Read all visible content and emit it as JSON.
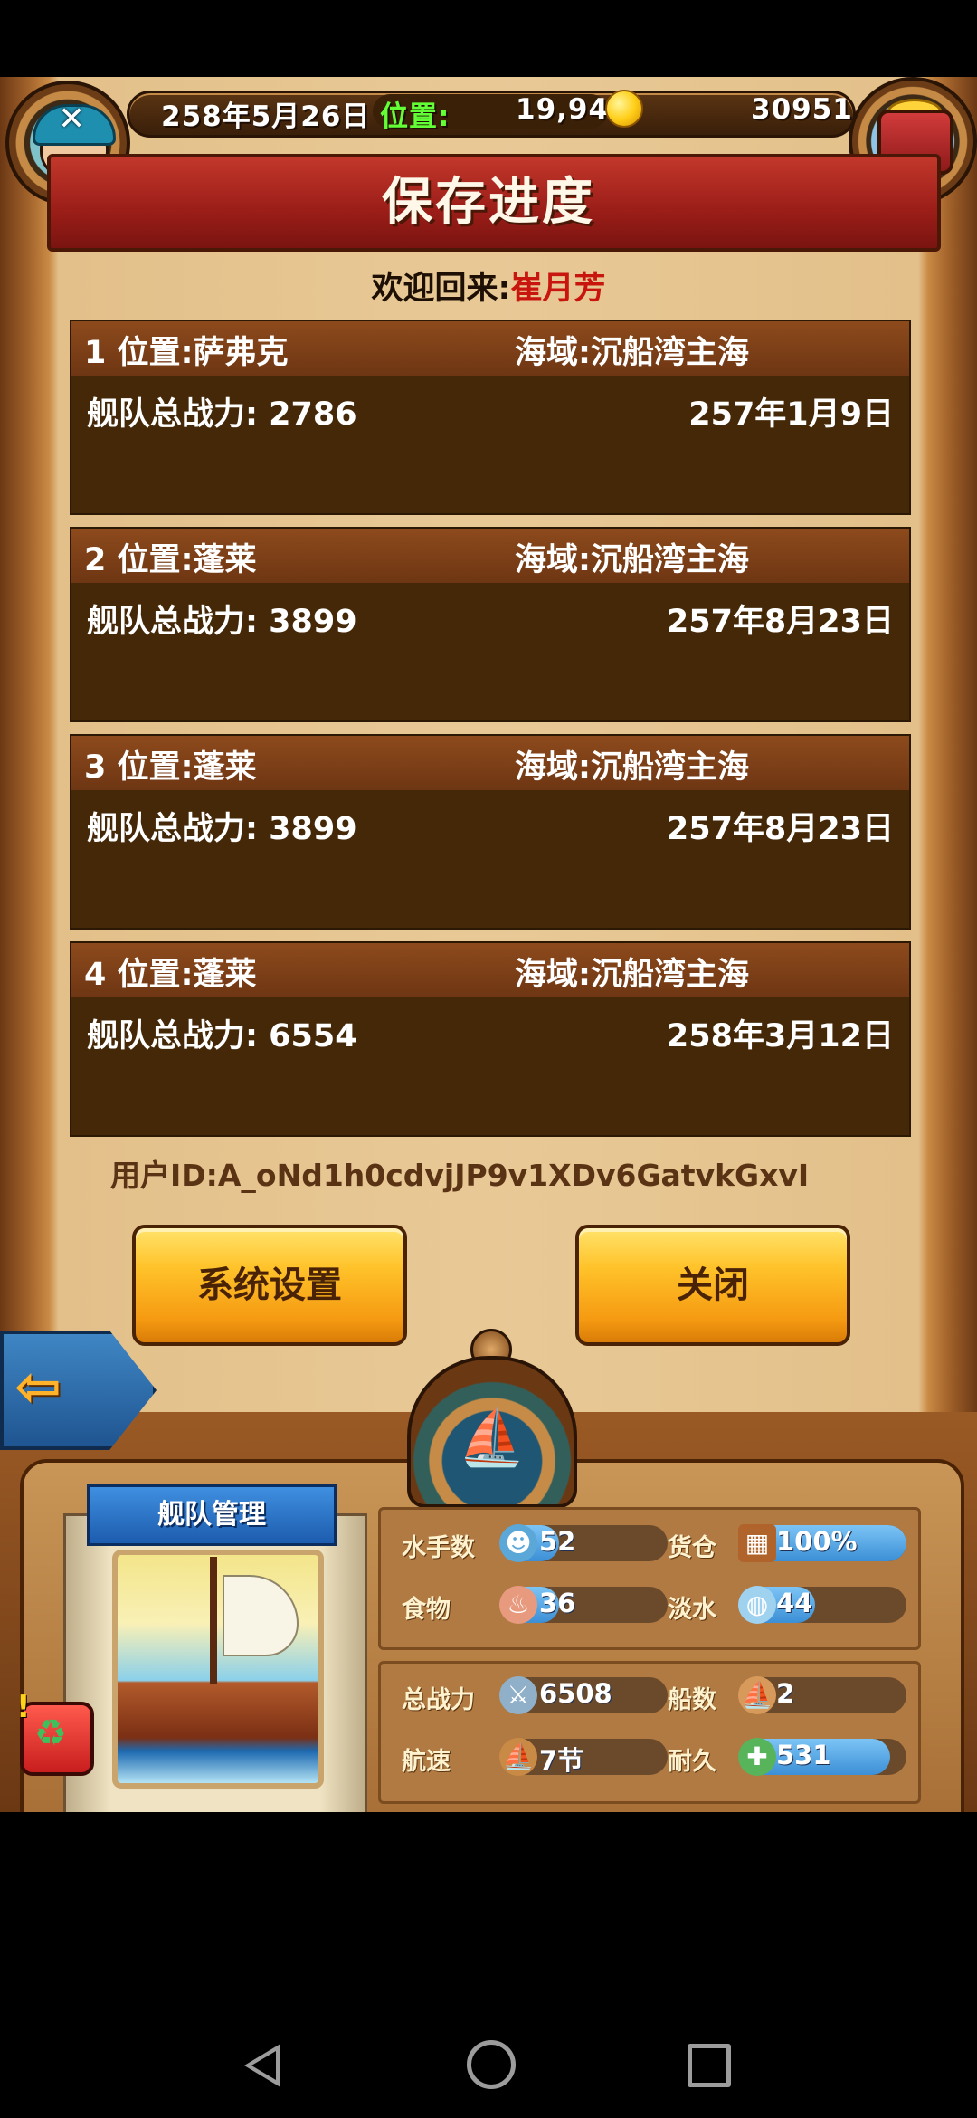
{
  "status": {
    "date": "258年5月26日",
    "location_label": "位置:",
    "coords": "19,94",
    "gold": "30951"
  },
  "dialog": {
    "title": "保存进度",
    "welcome_prefix": "欢迎回来:",
    "player_name": "崔月芳",
    "slots": [
      {
        "title": "1 位置:萨弗克",
        "sea": "海域:沉船湾主海",
        "power": "舰队总战力:  2786",
        "date": "257年1月9日"
      },
      {
        "title": "2 位置:蓬莱",
        "sea": "海域:沉船湾主海",
        "power": "舰队总战力:  3899",
        "date": "257年8月23日"
      },
      {
        "title": "3 位置:蓬莱",
        "sea": "海域:沉船湾主海",
        "power": "舰队总战力:  3899",
        "date": "257年8月23日"
      },
      {
        "title": "4 位置:蓬莱",
        "sea": "海域:沉船湾主海",
        "power": "舰队总战力:  6554",
        "date": "258年3月12日"
      }
    ],
    "user_id": "用户ID:A_oNd1h0cdvjJP9v1XDv6GatvkGxvI",
    "settings_button": "系统设置",
    "close_button": "关闭"
  },
  "fleet": {
    "tag": "舰队管理",
    "stats": {
      "sailors_label": "水手数",
      "sailors_value": "52",
      "sailors_fill": 0.35,
      "cargo_label": "货仓",
      "cargo_value": "100%",
      "cargo_fill": 1.0,
      "food_label": "食物",
      "food_value": "36",
      "food_fill": 0.35,
      "water_label": "淡水",
      "water_value": "44",
      "water_fill": 0.45,
      "power_label": "总战力",
      "power_value": "6508",
      "ships_label": "船数",
      "ships_value": "2",
      "speed_label": "航速",
      "speed_value": "7节",
      "durability_label": "耐久",
      "durability_value": "531",
      "durability_fill": 0.9
    }
  },
  "colors": {
    "accent_red": "#c8150e",
    "bar_blue": "#3b8fd6",
    "slot_brown": "#452808",
    "button_yellow": "#ffc229"
  }
}
